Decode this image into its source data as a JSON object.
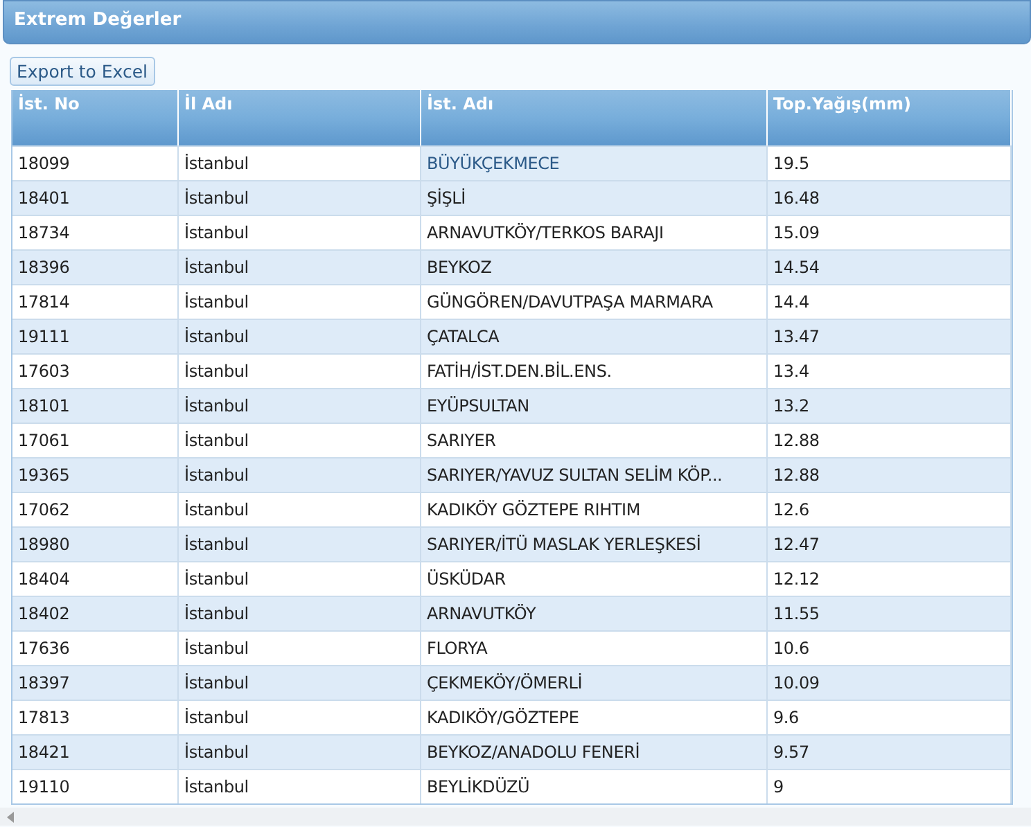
{
  "panel": {
    "title": "Extrem Değerler"
  },
  "export_button": "Export to Excel",
  "table": {
    "columns": [
      "İst. No",
      "İl Adı",
      "İst. Adı",
      "Top.Yağış(mm)"
    ],
    "rows": [
      {
        "cells": [
          "18099",
          "İstanbul",
          "BÜYÜKÇEKMECE",
          "19.5"
        ],
        "name_highlighted": true
      },
      {
        "cells": [
          "18401",
          "İstanbul",
          "ŞİŞLİ",
          "16.48"
        ],
        "name_highlighted": false
      },
      {
        "cells": [
          "18734",
          "İstanbul",
          "ARNAVUTKÖY/TERKOS BARAJI",
          "15.09"
        ],
        "name_highlighted": false
      },
      {
        "cells": [
          "18396",
          "İstanbul",
          "BEYKOZ",
          "14.54"
        ],
        "name_highlighted": false
      },
      {
        "cells": [
          "17814",
          "İstanbul",
          "GÜNGÖREN/DAVUTPAŞA MARMARA",
          "14.4"
        ],
        "name_highlighted": false
      },
      {
        "cells": [
          "19111",
          "İstanbul",
          "ÇATALCA",
          "13.47"
        ],
        "name_highlighted": false
      },
      {
        "cells": [
          "17603",
          "İstanbul",
          "FATİH/İST.DEN.BİL.ENS.",
          "13.4"
        ],
        "name_highlighted": false
      },
      {
        "cells": [
          "18101",
          "İstanbul",
          "EYÜPSULTAN",
          "13.2"
        ],
        "name_highlighted": false
      },
      {
        "cells": [
          "17061",
          "İstanbul",
          "SARIYER",
          "12.88"
        ],
        "name_highlighted": false
      },
      {
        "cells": [
          "19365",
          "İstanbul",
          "SARIYER/YAVUZ SULTAN SELİM KÖP...",
          "12.88"
        ],
        "name_highlighted": false
      },
      {
        "cells": [
          "17062",
          "İstanbul",
          "KADIKÖY GÖZTEPE RIHTIM",
          "12.6"
        ],
        "name_highlighted": false
      },
      {
        "cells": [
          "18980",
          "İstanbul",
          "SARIYER/İTÜ MASLAK YERLEŞKESİ",
          "12.47"
        ],
        "name_highlighted": false
      },
      {
        "cells": [
          "18404",
          "İstanbul",
          "ÜSKÜDAR",
          "12.12"
        ],
        "name_highlighted": false
      },
      {
        "cells": [
          "18402",
          "İstanbul",
          "ARNAVUTKÖY",
          "11.55"
        ],
        "name_highlighted": false
      },
      {
        "cells": [
          "17636",
          "İstanbul",
          "FLORYA",
          "10.6"
        ],
        "name_highlighted": false
      },
      {
        "cells": [
          "18397",
          "İstanbul",
          "ÇEKMEKÖY/ÖMERLİ",
          "10.09"
        ],
        "name_highlighted": false
      },
      {
        "cells": [
          "17813",
          "İstanbul",
          "KADIKÖY/GÖZTEPE",
          "9.6"
        ],
        "name_highlighted": false
      },
      {
        "cells": [
          "18421",
          "İstanbul",
          "BEYKOZ/ANADOLU FENERİ",
          "9.57"
        ],
        "name_highlighted": false
      },
      {
        "cells": [
          "19110",
          "İstanbul",
          "BEYLİKDÜZÜ",
          "9"
        ],
        "name_highlighted": false
      }
    ]
  }
}
